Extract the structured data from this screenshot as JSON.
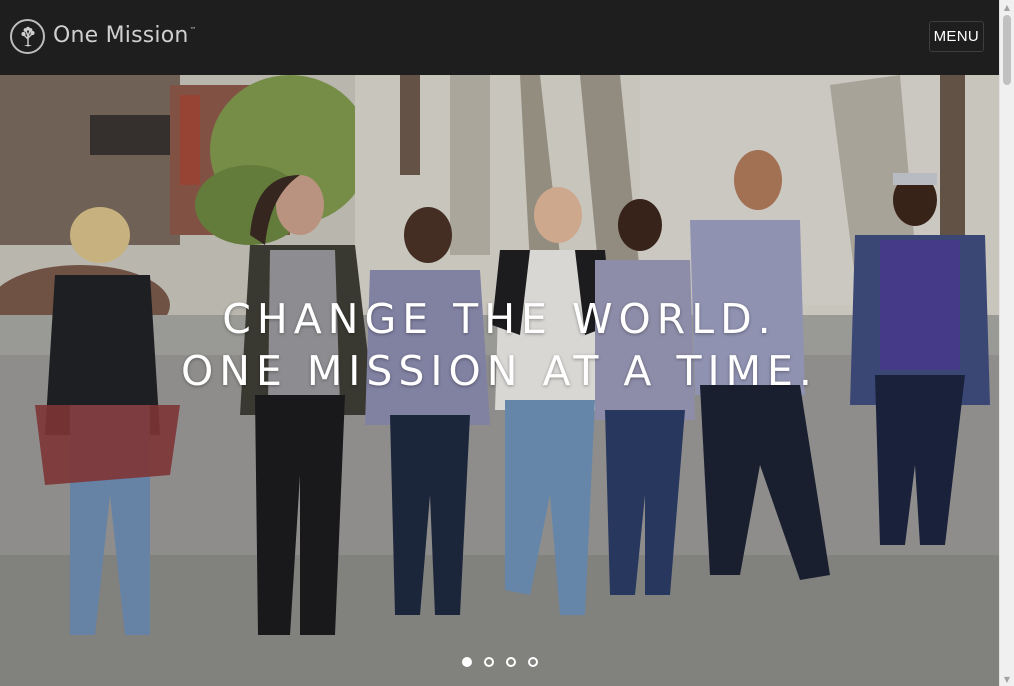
{
  "header": {
    "logo_text": "One Mission",
    "logo_tm": "™",
    "menu_label": "MENU"
  },
  "hero": {
    "headline_line1": "CHANGE THE WORLD.",
    "headline_line2": "ONE MISSION AT A TIME.",
    "slides_total": 4,
    "active_slide": 1
  },
  "colors": {
    "header_bg": "#1e1e1e",
    "text_white": "#ffffff",
    "logo_gray": "#cfcfcf"
  },
  "icons": {
    "logo_mark": "tree-circle-icon",
    "scroll_up": "chevron-up-icon",
    "scroll_down": "chevron-down-icon"
  }
}
